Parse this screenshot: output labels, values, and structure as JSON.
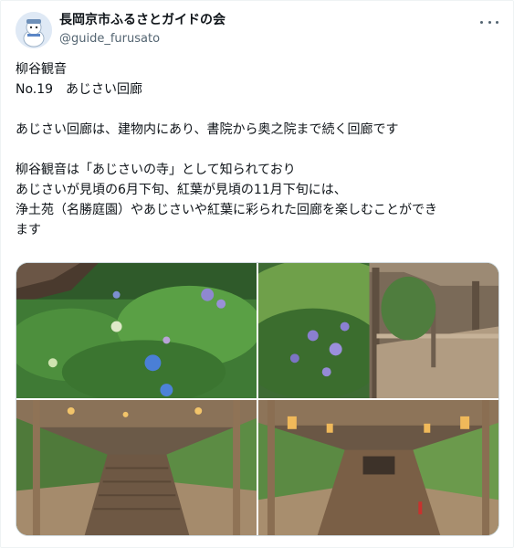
{
  "tweet": {
    "display_name": "長岡京市ふるさとガイドの会",
    "handle": "@guide_furusato",
    "text_lines": [
      "柳谷観音",
      "No.19　あじさい回廊",
      "",
      "あじさい回廊は、建物内にあり、書院から奥之院まで続く回廊です",
      "",
      "柳谷観音は「あじさいの寺」として知られており",
      "あじさいが見頃の6月下旬、紅葉が見頃の11月下旬には、",
      "浄土苑（名勝庭園）やあじさいや紅葉に彩られた回廊を楽しむことができ",
      "ます"
    ]
  },
  "icons": {
    "avatar": "mascot-avatar",
    "more": "more-options-icon"
  },
  "photos": [
    {
      "subject": "hydrangea-garden-photo"
    },
    {
      "subject": "hydrangea-and-wooden-corridor-photo"
    },
    {
      "subject": "corridor-staircase-photo"
    },
    {
      "subject": "corridor-with-lanterns-photo"
    }
  ],
  "colors": {
    "text": "#0f1419",
    "secondary": "#536471",
    "border": "#cfd9de"
  }
}
